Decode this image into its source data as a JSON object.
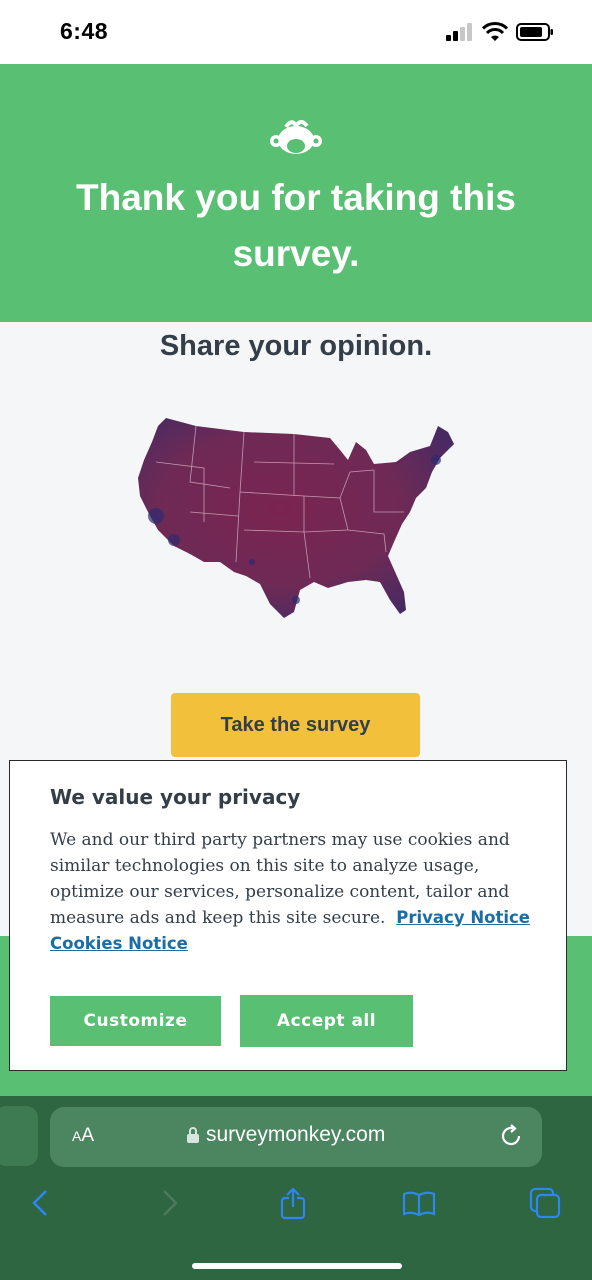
{
  "status": {
    "time": "6:48"
  },
  "header": {
    "title": "Thank you for taking this survey."
  },
  "content": {
    "subtitle": "Share your opinion.",
    "cta_label": "Take the survey"
  },
  "privacy": {
    "title": "We value your privacy",
    "body": "We and our third party partners may use cookies and similar technologies on this site to analyze usage, optimize our services, personalize content, tailor and measure ads and keep this site secure.",
    "privacy_link": "Privacy Notice",
    "cookies_link": "Cookies Notice",
    "customize_label": "Customize",
    "accept_label": "Accept all"
  },
  "browser": {
    "text_size_label_small": "A",
    "text_size_label_large": "A",
    "url": "surveymonkey.com"
  },
  "icons": {
    "logo": "surveymonkey-logo-icon",
    "lock": "lock-icon",
    "reload": "reload-icon",
    "back": "back-arrow-icon",
    "forward": "forward-arrow-icon",
    "share": "share-icon",
    "bookmarks": "bookmarks-icon",
    "tabs": "tabs-icon"
  },
  "colors": {
    "brand_green": "#59bf72",
    "cta_yellow": "#f2c03b",
    "link_blue": "#1a6ea3",
    "browser_green": "#2d6641"
  }
}
